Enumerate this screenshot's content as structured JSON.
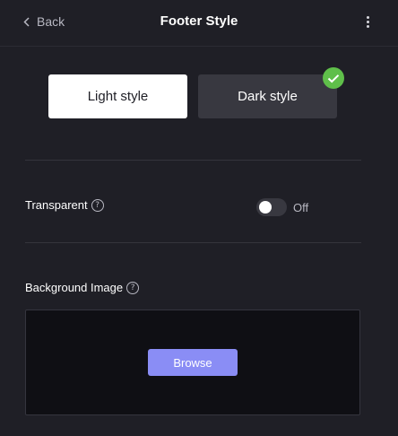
{
  "header": {
    "back_label": "Back",
    "title": "Footer Style"
  },
  "style_options": {
    "light_label": "Light style",
    "dark_label": "Dark style",
    "selected": "Dark style"
  },
  "transparent": {
    "label": "Transparent",
    "help": "?",
    "state_label": "Off"
  },
  "background_image": {
    "label": "Background Image",
    "help": "?",
    "browse_label": "Browse"
  },
  "colors": {
    "background": "#1f1f26",
    "accent_check": "#5fbf4a",
    "browse_button": "#8a8df5",
    "drop_area": "#0f0f14"
  }
}
